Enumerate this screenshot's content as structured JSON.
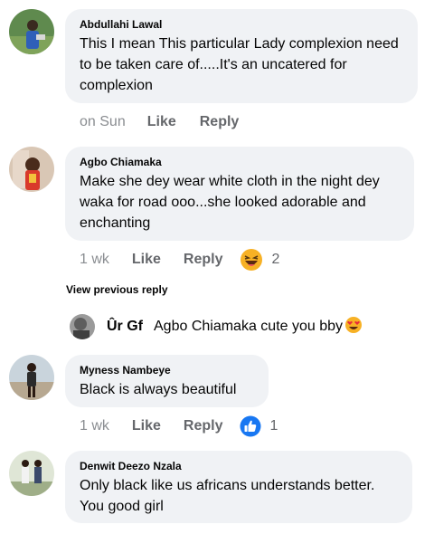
{
  "comments": [
    {
      "author": "Abdullahi Lawal",
      "text": "This I mean This particular Lady complexion need to be taken care of.....It's an uncatered for complexion",
      "time": "on Sun",
      "like_label": "Like",
      "reply_label": "Reply"
    },
    {
      "author": "Agbo Chiamaka",
      "text": "Make she dey wear white cloth in the night dey waka for road ooo...she looked adorable and enchanting",
      "time": "1 wk",
      "like_label": "Like",
      "reply_label": "Reply",
      "reaction_icon": "laughing-emoji-icon",
      "reaction_count": "2"
    },
    {
      "author": "Myness Nambeye",
      "text": "Black is always beautiful",
      "time": "1 wk",
      "like_label": "Like",
      "reply_label": "Reply",
      "reaction_icon": "thumbs-up-icon",
      "reaction_count": "1"
    },
    {
      "author": "Denwit Deezo Nzala",
      "text": "Only black like us africans understands better. You good girl"
    }
  ],
  "view_previous": "View previous reply",
  "reply": {
    "author": "Ûr Gf",
    "text": "Agbo Chiamaka cute you bby",
    "emoji_icon": "heart-eyes-emoji-icon"
  },
  "colors": {
    "bubble": "#f0f2f5",
    "meta_text": "#65676b",
    "like_blue": "#1877f2",
    "emoji_yellow": "#f7b125"
  }
}
